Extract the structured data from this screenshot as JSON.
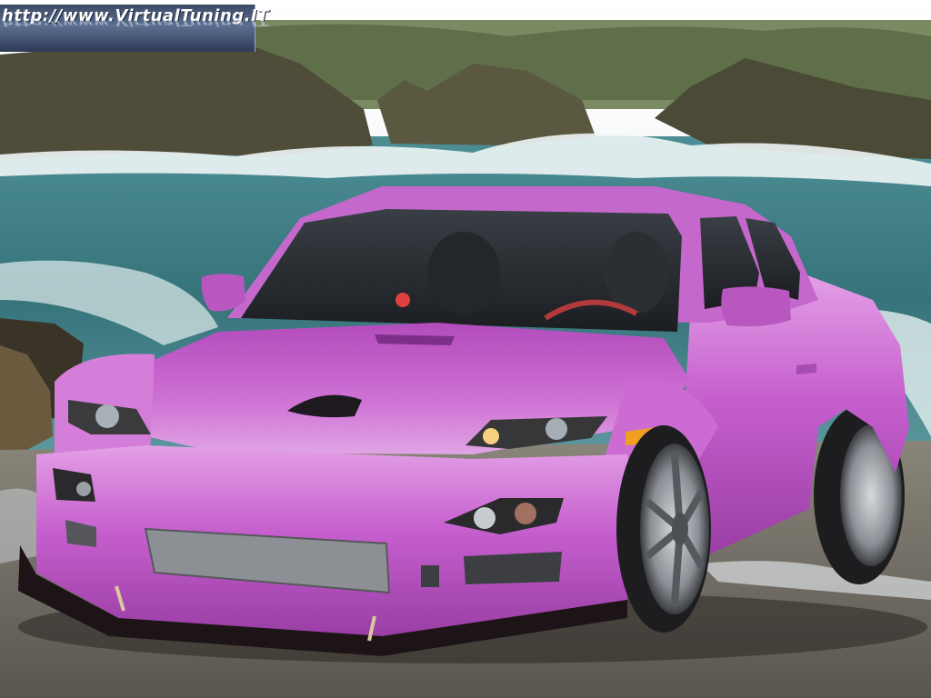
{
  "watermark": {
    "text": "http://www.VirtualTuning.IT"
  },
  "scene": {
    "subject": "car-icon",
    "colors": {
      "car_body": "#c45ccc",
      "car_highlight": "#e8a2ea",
      "car_shadow": "#8e3a98",
      "sea": "#3f7f86",
      "surf": "#e8f2f2",
      "rocks": "#5a5a44",
      "sky": "#e9eef0",
      "ground": "#6e6a62"
    }
  }
}
